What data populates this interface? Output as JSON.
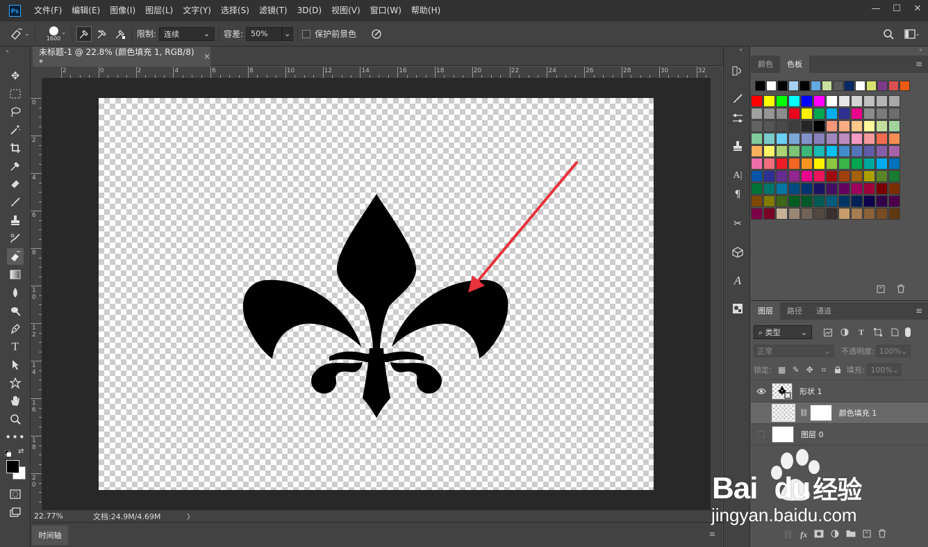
{
  "app": {
    "logo_text": "Ps"
  },
  "menu": [
    "文件(F)",
    "编辑(E)",
    "图像(I)",
    "图层(L)",
    "文字(Y)",
    "选择(S)",
    "滤镜(T)",
    "3D(D)",
    "视图(V)",
    "窗口(W)",
    "帮助(H)"
  ],
  "window_controls": {
    "minimize": "—",
    "maximize": "☐",
    "close": "✕"
  },
  "options": {
    "brush_size": "1600",
    "limit_label": "限制:",
    "limit_value": "连续",
    "tolerance_label": "容差:",
    "tolerance_value": "50%",
    "protect_fg_label": "保护前景色"
  },
  "document": {
    "tab_title": "未标题-1 @ 22.8% (颜色填充 1, RGB/8) *",
    "close_glyph": "×",
    "ruler_h_ticks": [
      "2",
      "0",
      "2",
      "4",
      "6",
      "8",
      "10",
      "12",
      "14",
      "16",
      "18",
      "20",
      "22",
      "24",
      "26",
      "28",
      "30",
      "32"
    ],
    "ruler_v_ticks": [
      "0",
      "2",
      "4",
      "6",
      "8",
      "1\n0",
      "1\n2",
      "1\n4",
      "1\n6",
      "1\n8",
      "2\n0"
    ]
  },
  "status": {
    "zoom": "22.77%",
    "doc_info": "文档:24.9M/4.69M",
    "arrow": "〉"
  },
  "timeline": {
    "tab_label": "时间轴"
  },
  "swatches_panel": {
    "tabs": [
      "颜色",
      "色板"
    ],
    "active_tab": "色板",
    "recent_colors": [
      "#000000",
      "#ffffff",
      "#000000",
      "#a6d1f0",
      "#000000",
      "#64a8e0",
      "#c8e0a0",
      "#5a5a5a",
      "#082864",
      "#ffffff",
      "#d8e070",
      "#7c3c8c",
      "#d85050",
      "#f05a14"
    ],
    "swatch_rows": [
      [
        "#ff0000",
        "#ffff00",
        "#00ff00",
        "#00ffff",
        "#0000ff",
        "#ff00ff",
        "#ffffff",
        "#e6e6e6",
        "#d4d4d4",
        "#c0c0c0",
        "#b4b4b4",
        "#a8a8a8"
      ],
      [
        "#a0a0a0",
        "#969696",
        "#8c8c8c",
        "#e8001c",
        "#fff200",
        "#00a650",
        "#00aeef",
        "#2e3192",
        "#ec008c",
        "#8c8c8c",
        "#7c7c7c",
        "#6e6e6e"
      ],
      [
        "#626262",
        "#565656",
        "#4a4a4a",
        "#3e3e3e",
        "#262626",
        "#000000",
        "#f7977a",
        "#f9ad81",
        "#fdc68a",
        "#fff79a",
        "#c4df9b",
        "#a2d39c"
      ],
      [
        "#82ca9c",
        "#7accc8",
        "#6dcff6",
        "#7da7d9",
        "#8393ca",
        "#8781bd",
        "#a187be",
        "#bd8cbf",
        "#f49ac2",
        "#f6989d",
        "#f26c4f",
        "#f68e55"
      ],
      [
        "#fbaf5c",
        "#fff467",
        "#acd372",
        "#7cc576",
        "#3bb878",
        "#1abbb4",
        "#00bff3",
        "#438ccb",
        "#5574b9",
        "#605ca8",
        "#8560a8",
        "#a863a8"
      ],
      [
        "#f06ea9",
        "#f26d7d",
        "#ed1c24",
        "#f26522",
        "#f7941d",
        "#fff200",
        "#8dc63f",
        "#39b54a",
        "#00a651",
        "#00a99d",
        "#00aeef",
        "#0072bc"
      ],
      [
        "#0054a6",
        "#2e3192",
        "#662d91",
        "#92278f",
        "#ec008c",
        "#ed145b",
        "#9e0b0f",
        "#a0410d",
        "#a36209",
        "#aba000",
        "#598527",
        "#197b30"
      ],
      [
        "#007236",
        "#00746b",
        "#0076a3",
        "#004a80",
        "#003471",
        "#1b1464",
        "#440e62",
        "#630460",
        "#9e005d",
        "#9e0039",
        "#790000",
        "#7b2e00"
      ],
      [
        "#7d4900",
        "#827b00",
        "#406618",
        "#005e20",
        "#005826",
        "#005952",
        "#005b7f",
        "#003663",
        "#002157",
        "#0d004c",
        "#32004b",
        "#4b0049"
      ],
      [
        "#7b0046",
        "#7a0026",
        "#c7b299",
        "#998675",
        "#736357",
        "#534741",
        "#37302d",
        "#c69c6d",
        "#a67c52",
        "#8c6239",
        "#754c24",
        "#603913"
      ]
    ],
    "footer_icons": [
      "new-swatch-icon",
      "trash-icon"
    ]
  },
  "layers_panel": {
    "tabs": [
      "图层",
      "路径",
      "通道"
    ],
    "active_tab": "图层",
    "filter_label": "类型",
    "blend_mode": "正常",
    "opacity_label": "不透明度:",
    "opacity_value": "100%",
    "lock_label": "锁定:",
    "fill_label": "填充:",
    "fill_value": "100%",
    "layers": [
      {
        "name": "形状 1",
        "visible": true,
        "thumb": "shape"
      },
      {
        "name": "颜色填充 1",
        "visible": false,
        "thumb": "fill",
        "selected": true
      },
      {
        "name": "图层 0",
        "visible": false,
        "thumb": "white"
      }
    ],
    "footer_icons": [
      "link-icon",
      "fx-icon",
      "mask-icon",
      "adjustment-icon",
      "folder-icon",
      "new-layer-icon",
      "trash-icon"
    ]
  },
  "watermark": {
    "text1": "Bai",
    "text2": "du",
    "text3": "经验",
    "url": "jingyan.baidu.com"
  },
  "colors": {
    "accent_arrow": "#e8323c",
    "shape": "#000000"
  }
}
